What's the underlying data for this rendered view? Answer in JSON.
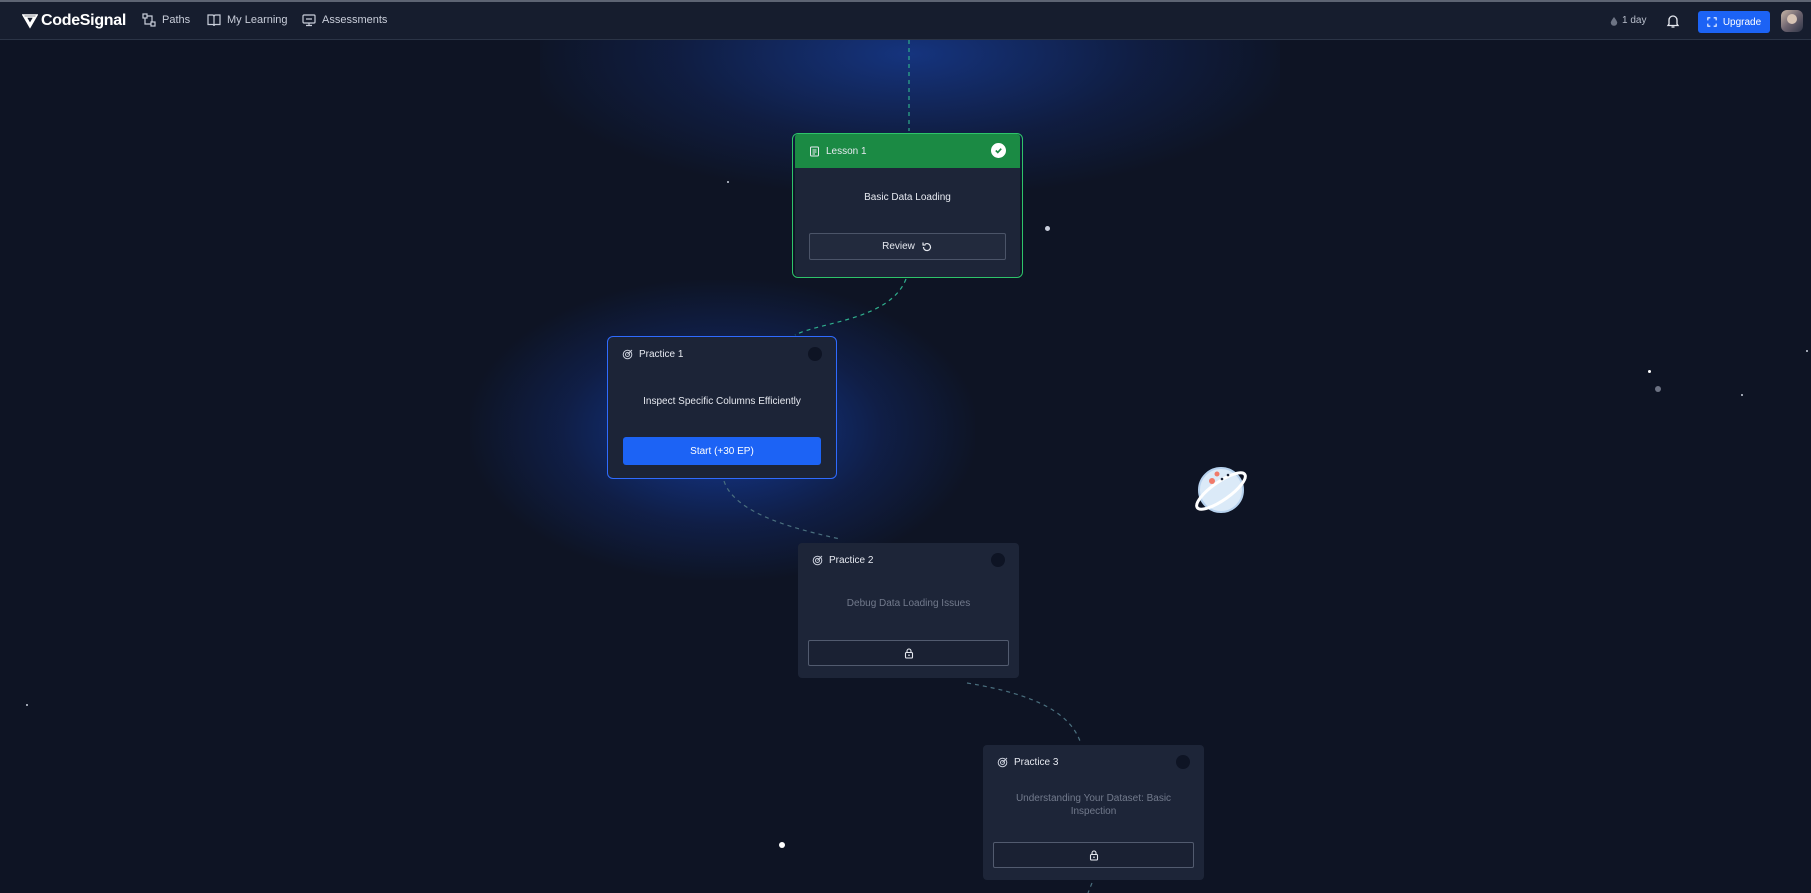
{
  "header": {
    "brand": "CodeSignal",
    "nav": [
      {
        "label": "Paths",
        "icon": "paths-icon"
      },
      {
        "label": "My Learning",
        "icon": "book-icon"
      },
      {
        "label": "Assessments",
        "icon": "assessments-icon"
      }
    ],
    "streak": "1 day",
    "upgrade_label": "Upgrade"
  },
  "lesson1": {
    "label": "Lesson 1",
    "title": "Basic Data Loading",
    "button": "Review",
    "status": "completed"
  },
  "practice1": {
    "label": "Practice 1",
    "title": "Inspect Specific Columns Efficiently",
    "button": "Start (+30 EP)"
  },
  "practice2": {
    "label": "Practice 2",
    "title": "Debug Data Loading Issues",
    "status": "locked"
  },
  "practice3": {
    "label": "Practice 3",
    "title": "Understanding Your Dataset: Basic Inspection",
    "status": "locked"
  },
  "colors": {
    "background": "#0e1424",
    "card": "#1d2538",
    "completed": "#1b8a44",
    "accent": "#1c63f5",
    "line": "#2fae8c"
  }
}
